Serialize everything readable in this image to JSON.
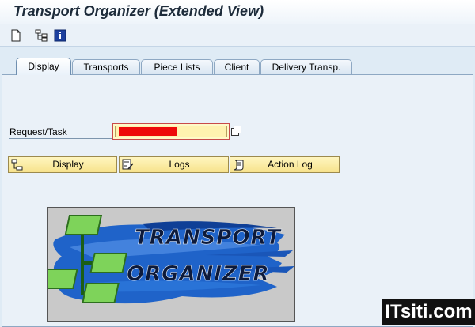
{
  "window": {
    "title": "Transport Organizer (Extended View)"
  },
  "toolbar": {
    "icons": [
      "new-document-icon",
      "hierarchy-icon",
      "information-icon"
    ]
  },
  "tabs": [
    {
      "label": "Display",
      "active": true
    },
    {
      "label": "Transports",
      "active": false
    },
    {
      "label": "Piece Lists",
      "active": false
    },
    {
      "label": "Client",
      "active": false
    },
    {
      "label": "Delivery Transp.",
      "active": false
    }
  ],
  "form": {
    "request_label": "Request/Task",
    "request_value": "",
    "field_highlight_color": "#ee0a0a"
  },
  "buttons": {
    "display_label": "Display",
    "logs_label": "Logs",
    "action_log_label": "Action Log"
  },
  "logo": {
    "line1": "TRANSPORT",
    "line2": "ORGANIZER"
  },
  "watermark": {
    "text": "ITsiti.com"
  }
}
